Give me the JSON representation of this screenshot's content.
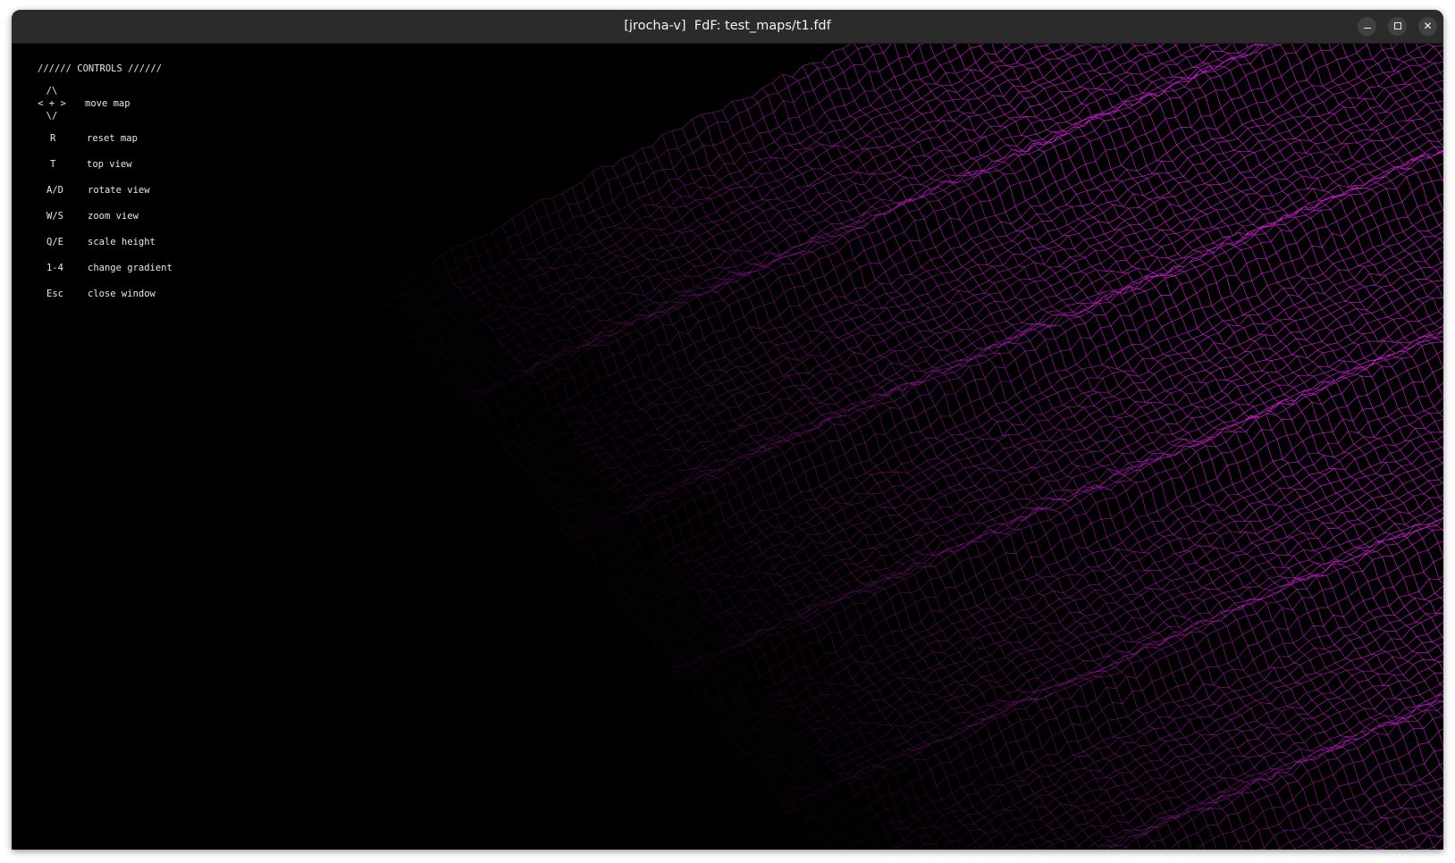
{
  "window": {
    "title": "[jrocha-v]  FdF: test_maps/t1.fdf",
    "buttons": {
      "minimize": "minimize",
      "maximize": "maximize",
      "close": "close"
    }
  },
  "controls": {
    "heading": "////// CONTROLS //////",
    "arrows": {
      "up": "/\\",
      "middle": "< + >",
      "down": "\\/"
    },
    "items": [
      {
        "key": "",
        "label": "move map"
      },
      {
        "key": "R",
        "label": "reset map"
      },
      {
        "key": "T",
        "label": "top view"
      },
      {
        "key": "A/D",
        "label": "rotate view"
      },
      {
        "key": "W/S",
        "label": "zoom view"
      },
      {
        "key": "Q/E",
        "label": "scale height"
      },
      {
        "key": "1-4",
        "label": "change gradient"
      },
      {
        "key": "Esc",
        "label": "close window"
      }
    ]
  },
  "render": {
    "mesh_color": "#e020e8",
    "background": "#000000"
  }
}
